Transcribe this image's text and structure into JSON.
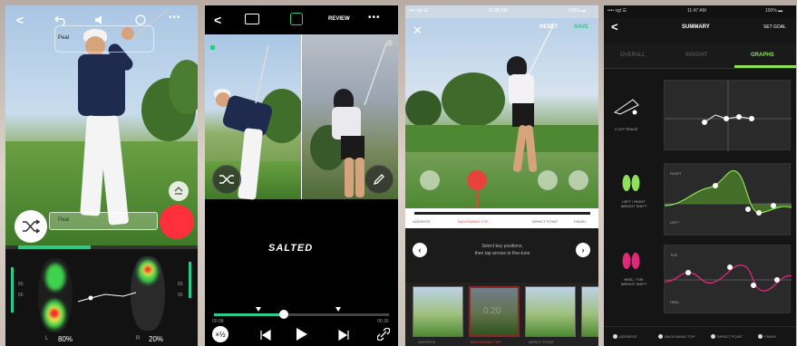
{
  "panel1": {
    "label_left": "L",
    "value_left": "80%",
    "label_right": "R",
    "value_right": "20%",
    "tag_top": "Peal",
    "tag_bottom": "Peal",
    "scale_left": [
      "65",
      "65"
    ],
    "scale_right": [
      "65",
      "65"
    ],
    "more": "•••",
    "back": "<"
  },
  "panel2": {
    "back": "<",
    "review_label": "REVIEW",
    "more": "•••",
    "brand": "SALTED",
    "time_start": "00:08",
    "time_end": "00:30"
  },
  "panel3": {
    "status_carrier": "•••• sgt ☰",
    "status_time": "11:05 AM",
    "status_battery": "100% ▬",
    "close": "✕",
    "reset": "RESET",
    "save": "SAVE",
    "positions": [
      "ADDRESS",
      "BACKSWING TOP",
      "IMPACT POINT",
      "FINISH"
    ],
    "instructions": "Select key positions,\nthen tap arrows to fine-tune",
    "thumb_value": "0.20",
    "thumb_labels": [
      "ADDRESS",
      "BACKSWING TOP",
      "IMPACT POINT",
      ""
    ],
    "accent_red": "#e8423d",
    "accent_green": "#2ec98a"
  },
  "panel4": {
    "status_carrier": "•••• sgt ☰",
    "status_time": "11:47 AM",
    "status_battery": "100% ▬",
    "back": "<",
    "title": "SUMMARY",
    "set_goal": "SET GOAL",
    "tabs": [
      "OVERALL",
      "INSIGHT",
      "GRAPHS"
    ],
    "rows": [
      {
        "label": "C.O.P TRACE",
        "icon": "club-path-icon"
      },
      {
        "label": "LEFT / RIGHT\nWEIGHT SHIFT",
        "icon": "feet-green-icon",
        "top": "RIGHT",
        "bottom": "LEFT"
      },
      {
        "label": "HEEL / TOE\nWEIGHT SHIFT",
        "icon": "feet-pink-icon",
        "top": "TOE",
        "bottom": "HEEL"
      }
    ],
    "legend": [
      "ADDRESS",
      "BACKSWING TOP",
      "IMPACT POINT",
      "FINISH"
    ],
    "accent_green": "#8ee05a",
    "accent_pink": "#e0287a"
  }
}
